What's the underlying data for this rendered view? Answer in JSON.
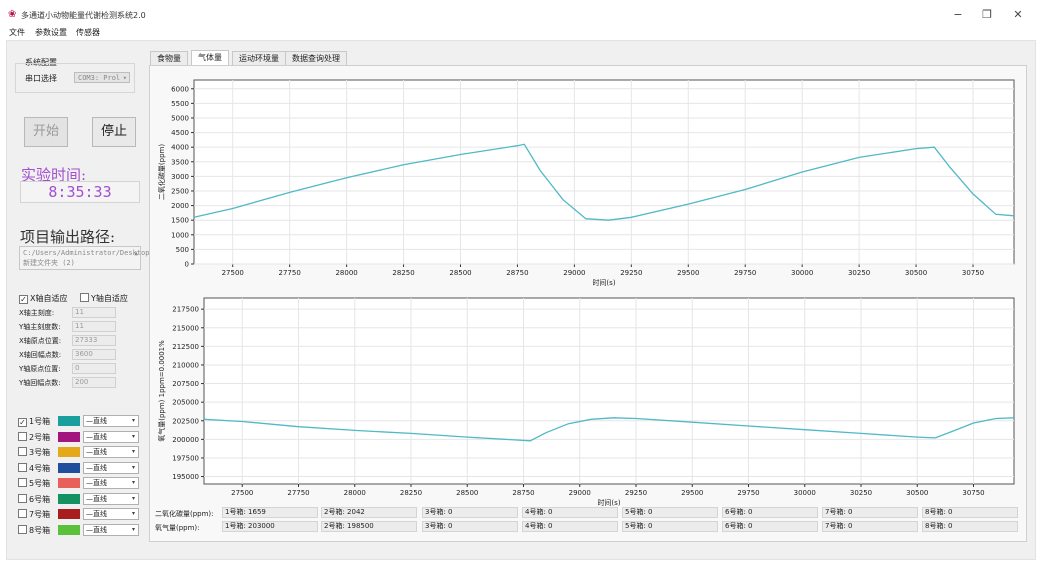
{
  "window": {
    "title": "多通道小动物能量代谢检测系统2.0",
    "minimize": "−",
    "restore": "❐",
    "close": "✕",
    "icon": "app-logo-icon"
  },
  "menu": [
    "文件",
    "参数设置",
    "传感器"
  ],
  "system_config": {
    "title": "系统配置",
    "port_label": "串口选择",
    "port_value": "COM3: Prol"
  },
  "controls": {
    "start": "开始",
    "stop": "停止"
  },
  "experiment": {
    "time_label": "实验时间:",
    "time_value": "8:35:33"
  },
  "output": {
    "label": "项目输出路径:",
    "path": "C:/Users/Administrator/Desktop/新建文件夹 (2)"
  },
  "axis_settings": {
    "x_auto": "X轴自适应",
    "x_auto_checked": true,
    "y_auto": "Y轴自适应",
    "y_auto_checked": false,
    "params": [
      {
        "label": "X轴主刻度:",
        "value": "11"
      },
      {
        "label": "Y轴主刻度数:",
        "value": "11"
      },
      {
        "label": "X轴原点位置:",
        "value": "27333"
      },
      {
        "label": "X轴回幅点数:",
        "value": "3600"
      },
      {
        "label": "Y轴原点位置:",
        "value": "0"
      },
      {
        "label": "Y轴回幅点数:",
        "value": "200"
      }
    ]
  },
  "boxes": [
    {
      "label": "1号箱",
      "checked": true,
      "color": "#1a9e9e",
      "line": "直线"
    },
    {
      "label": "2号箱",
      "checked": false,
      "color": "#a4147e",
      "line": "直线"
    },
    {
      "label": "3号箱",
      "checked": false,
      "color": "#e5a81a",
      "line": "直线"
    },
    {
      "label": "4号箱",
      "checked": false,
      "color": "#1f4f9c",
      "line": "直线"
    },
    {
      "label": "5号箱",
      "checked": false,
      "color": "#e8605a",
      "line": "直线"
    },
    {
      "label": "6号箱",
      "checked": false,
      "color": "#159263",
      "line": "直线"
    },
    {
      "label": "7号箱",
      "checked": false,
      "color": "#a81d1d",
      "line": "直线"
    },
    {
      "label": "8号箱",
      "checked": false,
      "color": "#5bc13a",
      "line": "直线"
    }
  ],
  "tabs": [
    "食物量",
    "气体量",
    "运动环境量",
    "数据查询处理"
  ],
  "active_tab": 1,
  "co2_row": {
    "label": "二氧化碳量(ppm):",
    "cells": [
      "1号箱: 1659",
      "2号箱: 2042",
      "3号箱: 0",
      "4号箱: 0",
      "5号箱: 0",
      "6号箱: 0",
      "7号箱: 0",
      "8号箱: 0"
    ]
  },
  "o2_row": {
    "label": "氧气量(ppm):",
    "cells": [
      "1号箱: 203000",
      "2号箱: 198500",
      "3号箱: 0",
      "4号箱: 0",
      "5号箱: 0",
      "6号箱: 0",
      "7号箱: 0",
      "8号箱: 0"
    ]
  },
  "chart_data": [
    {
      "type": "line",
      "ylabel": "二氧化碳量(ppm)",
      "xlabel": "时间(s)",
      "xlim": [
        27330,
        30930
      ],
      "ylim": [
        0,
        6300
      ],
      "x_ticks": [
        27500,
        27750,
        28000,
        28250,
        28500,
        28750,
        29000,
        29250,
        29500,
        29750,
        30000,
        30250,
        30500,
        30750
      ],
      "y_ticks": [
        0,
        500,
        1000,
        1500,
        2000,
        2500,
        3000,
        3500,
        4000,
        4500,
        5000,
        5500,
        6000
      ],
      "grid": true,
      "series": [
        {
          "color": "#4fb9c6",
          "x": [
            27330,
            27500,
            27750,
            28000,
            28250,
            28500,
            28750,
            28780,
            28850,
            28950,
            29050,
            29150,
            29250,
            29500,
            29750,
            30000,
            30250,
            30500,
            30580,
            30650,
            30750,
            30850,
            30930
          ],
          "y": [
            1600,
            1900,
            2450,
            2950,
            3400,
            3750,
            4050,
            4100,
            3200,
            2200,
            1550,
            1500,
            1600,
            2050,
            2550,
            3150,
            3650,
            3950,
            4000,
            3300,
            2400,
            1700,
            1650
          ]
        }
      ]
    },
    {
      "type": "line",
      "ylabel": "氧气量(ppm) 1ppm=0.0001%",
      "xlabel": "时间(s)",
      "xlim": [
        27330,
        30930
      ],
      "ylim": [
        194000,
        219000
      ],
      "x_ticks": [
        27500,
        27750,
        28000,
        28250,
        28500,
        28750,
        29000,
        29250,
        29500,
        29750,
        30000,
        30250,
        30500,
        30750
      ],
      "y_ticks": [
        195000,
        197500,
        200000,
        202500,
        205000,
        207500,
        210000,
        212500,
        215000,
        217500
      ],
      "grid": true,
      "series": [
        {
          "color": "#4fb9c6",
          "x": [
            27330,
            27500,
            27750,
            28000,
            28250,
            28500,
            28780,
            28850,
            28950,
            29050,
            29150,
            29250,
            29500,
            29750,
            30000,
            30250,
            30500,
            30580,
            30650,
            30750,
            30850,
            30930
          ],
          "y": [
            202700,
            202400,
            201700,
            201200,
            200800,
            200300,
            199800,
            200900,
            202100,
            202700,
            202900,
            202800,
            202300,
            201800,
            201300,
            200800,
            200300,
            200200,
            201000,
            202200,
            202800,
            202900
          ]
        }
      ]
    }
  ]
}
